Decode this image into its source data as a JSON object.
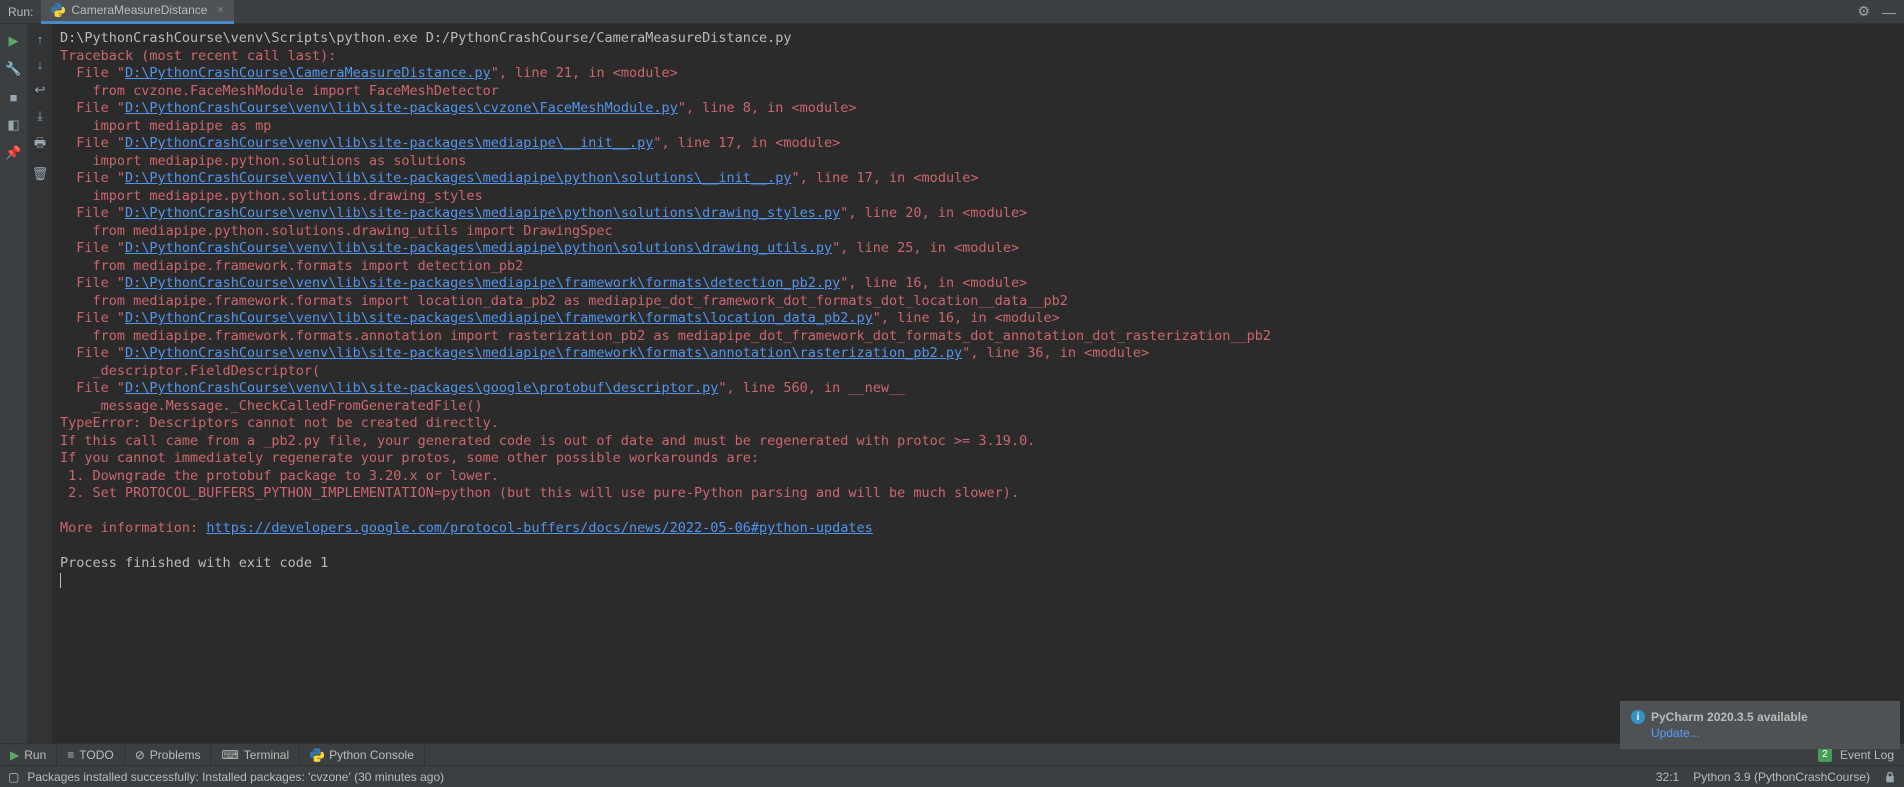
{
  "header": {
    "runLabel": "Run:",
    "tabName": "CameraMeasureDistance"
  },
  "console": {
    "cmdLine": "D:\\PythonCrashCourse\\venv\\Scripts\\python.exe D:/PythonCrashCourse/CameraMeasureDistance.py",
    "tracebackHeader": "Traceback (most recent call last):",
    "frames": [
      {
        "pre": "  File \"",
        "link": "D:\\PythonCrashCourse\\CameraMeasureDistance.py",
        "post": "\", line 21, in <module>",
        "code": "    from cvzone.FaceMeshModule import FaceMeshDetector"
      },
      {
        "pre": "  File \"",
        "link": "D:\\PythonCrashCourse\\venv\\lib\\site-packages\\cvzone\\FaceMeshModule.py",
        "post": "\", line 8, in <module>",
        "code": "    import mediapipe as mp"
      },
      {
        "pre": "  File \"",
        "link": "D:\\PythonCrashCourse\\venv\\lib\\site-packages\\mediapipe\\__init__.py",
        "post": "\", line 17, in <module>",
        "code": "    import mediapipe.python.solutions as solutions"
      },
      {
        "pre": "  File \"",
        "link": "D:\\PythonCrashCourse\\venv\\lib\\site-packages\\mediapipe\\python\\solutions\\__init__.py",
        "post": "\", line 17, in <module>",
        "code": "    import mediapipe.python.solutions.drawing_styles"
      },
      {
        "pre": "  File \"",
        "link": "D:\\PythonCrashCourse\\venv\\lib\\site-packages\\mediapipe\\python\\solutions\\drawing_styles.py",
        "post": "\", line 20, in <module>",
        "code": "    from mediapipe.python.solutions.drawing_utils import DrawingSpec"
      },
      {
        "pre": "  File \"",
        "link": "D:\\PythonCrashCourse\\venv\\lib\\site-packages\\mediapipe\\python\\solutions\\drawing_utils.py",
        "post": "\", line 25, in <module>",
        "code": "    from mediapipe.framework.formats import detection_pb2"
      },
      {
        "pre": "  File \"",
        "link": "D:\\PythonCrashCourse\\venv\\lib\\site-packages\\mediapipe\\framework\\formats\\detection_pb2.py",
        "post": "\", line 16, in <module>",
        "code": "    from mediapipe.framework.formats import location_data_pb2 as mediapipe_dot_framework_dot_formats_dot_location__data__pb2"
      },
      {
        "pre": "  File \"",
        "link": "D:\\PythonCrashCourse\\venv\\lib\\site-packages\\mediapipe\\framework\\formats\\location_data_pb2.py",
        "post": "\", line 16, in <module>",
        "code": "    from mediapipe.framework.formats.annotation import rasterization_pb2 as mediapipe_dot_framework_dot_formats_dot_annotation_dot_rasterization__pb2"
      },
      {
        "pre": "  File \"",
        "link": "D:\\PythonCrashCourse\\venv\\lib\\site-packages\\mediapipe\\framework\\formats\\annotation\\rasterization_pb2.py",
        "post": "\", line 36, in <module>",
        "code": "    _descriptor.FieldDescriptor("
      },
      {
        "pre": "  File \"",
        "link": "D:\\PythonCrashCourse\\venv\\lib\\site-packages\\google\\protobuf\\descriptor.py",
        "post": "\", line 560, in __new__",
        "code": "    _message.Message._CheckCalledFromGeneratedFile()"
      }
    ],
    "errorLines": [
      "TypeError: Descriptors cannot not be created directly.",
      "If this call came from a _pb2.py file, your generated code is out of date and must be regenerated with protoc >= 3.19.0.",
      "If you cannot immediately regenerate your protos, some other possible workarounds are:",
      " 1. Downgrade the protobuf package to 3.20.x or lower.",
      " 2. Set PROTOCOL_BUFFERS_PYTHON_IMPLEMENTATION=python (but this will use pure-Python parsing and will be much slower)."
    ],
    "moreInfoLabel": "More information: ",
    "moreInfoLink": "https://developers.google.com/protocol-buffers/docs/news/2022-05-06#python-updates",
    "exitLine": "Process finished with exit code 1"
  },
  "notification": {
    "title": "PyCharm 2020.3.5 available",
    "link": "Update..."
  },
  "bottomToolbar": {
    "run": "Run",
    "todo": "TODO",
    "problems": "Problems",
    "terminal": "Terminal",
    "pyconsole": "Python Console",
    "eventCount": "2",
    "eventLog": "Event Log"
  },
  "statusBar": {
    "message": "Packages installed successfully: Installed packages: 'cvzone' (30 minutes ago)",
    "cursor": "32:1",
    "interpreter": "Python 3.9 (PythonCrashCourse)"
  }
}
